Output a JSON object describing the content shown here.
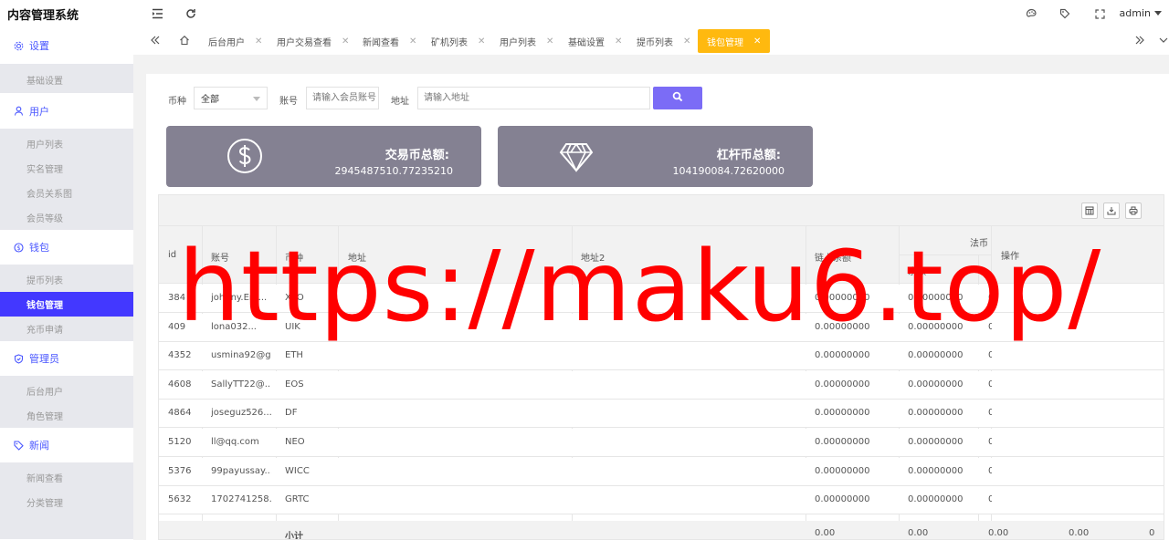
{
  "app": {
    "title": "内容管理系统",
    "user": "admin"
  },
  "sidebar": {
    "groups": [
      {
        "label": "设置",
        "icon": "gear-icon",
        "items": [
          "基础设置"
        ]
      },
      {
        "label": "用户",
        "icon": "user-icon",
        "items": [
          "用户列表",
          "实名管理",
          "会员关系图",
          "会员等级"
        ]
      },
      {
        "label": "钱包",
        "icon": "dollar-circle-icon",
        "items": [
          "提币列表",
          "钱包管理",
          "充币申请"
        ]
      },
      {
        "label": "管理员",
        "icon": "shield-icon",
        "items": [
          "后台用户",
          "角色管理"
        ]
      },
      {
        "label": "新闻",
        "icon": "tag-icon",
        "items": [
          "新闻查看",
          "分类管理"
        ]
      }
    ],
    "active_item": "钱包管理"
  },
  "tabs": [
    {
      "label": "后台用户",
      "closable": true
    },
    {
      "label": "用户交易查看",
      "closable": true
    },
    {
      "label": "新闻查看",
      "closable": true
    },
    {
      "label": "矿机列表",
      "closable": true
    },
    {
      "label": "用户列表",
      "closable": true
    },
    {
      "label": "基础设置",
      "closable": true
    },
    {
      "label": "提币列表",
      "closable": true
    },
    {
      "label": "钱包管理",
      "closable": true,
      "active": true
    }
  ],
  "filters": {
    "currency_label": "币种",
    "currency_value": "全部",
    "account_label": "账号",
    "account_placeholder": "请输入会员账号",
    "address_label": "地址",
    "address_placeholder": "请输入地址"
  },
  "stats": [
    {
      "label": "交易币总额:",
      "value": "2945487510.77235210",
      "icon": "dollar-icon"
    },
    {
      "label": "杠杆币总额:",
      "value": "104190084.72620000",
      "icon": "diamond-icon"
    }
  ],
  "table": {
    "headers": {
      "id": "id",
      "account": "账号",
      "currency": "币种",
      "address": "地址",
      "address2": "地址2",
      "chain_balance": "链上余额",
      "fiat_group": "法币",
      "fiat_balance": "余额",
      "actions": "操作"
    },
    "rows": [
      {
        "id": "384",
        "account": "johnny.Em...",
        "currency": "XPO",
        "address": "",
        "address2": "",
        "chain_balance": "0.00000000",
        "fiat_balance": "0.00000000",
        "extra": "0"
      },
      {
        "id": "409",
        "account": "lona032...",
        "currency": "UIK",
        "address": "",
        "address2": "",
        "chain_balance": "0.00000000",
        "fiat_balance": "0.00000000",
        "extra": "0"
      },
      {
        "id": "4352",
        "account": "usmina92@g...",
        "currency": "ETH",
        "address": "",
        "address2": "",
        "chain_balance": "0.00000000",
        "fiat_balance": "0.00000000",
        "extra": "0"
      },
      {
        "id": "4608",
        "account": "SallyTT22@...",
        "currency": "EOS",
        "address": "",
        "address2": "",
        "chain_balance": "0.00000000",
        "fiat_balance": "0.00000000",
        "extra": "0"
      },
      {
        "id": "4864",
        "account": "joseguz526...",
        "currency": "DF",
        "address": "",
        "address2": "",
        "chain_balance": "0.00000000",
        "fiat_balance": "0.00000000",
        "extra": "0"
      },
      {
        "id": "5120",
        "account": "ll@qq.com",
        "currency": "NEO",
        "address": "",
        "address2": "",
        "chain_balance": "0.00000000",
        "fiat_balance": "0.00000000",
        "extra": "0"
      },
      {
        "id": "5376",
        "account": "99payussay...",
        "currency": "WICC",
        "address": "",
        "address2": "",
        "chain_balance": "0.00000000",
        "fiat_balance": "0.00000000",
        "extra": "0"
      },
      {
        "id": "5632",
        "account": "1702741258...",
        "currency": "GRTC",
        "address": "",
        "address2": "",
        "chain_balance": "0.00000000",
        "fiat_balance": "0.00000000",
        "extra": "0"
      }
    ],
    "footer": {
      "label": "小计",
      "values": [
        "0.00",
        "0.00",
        "0.00",
        "0.00",
        "0"
      ]
    }
  },
  "watermark": "https://maku6.top/",
  "colors": {
    "accent": "#4338ff",
    "active_tab": "#ffb90f",
    "search_button": "#7b6cf6",
    "stat_card": "#848192",
    "watermark": "#ff0000"
  }
}
